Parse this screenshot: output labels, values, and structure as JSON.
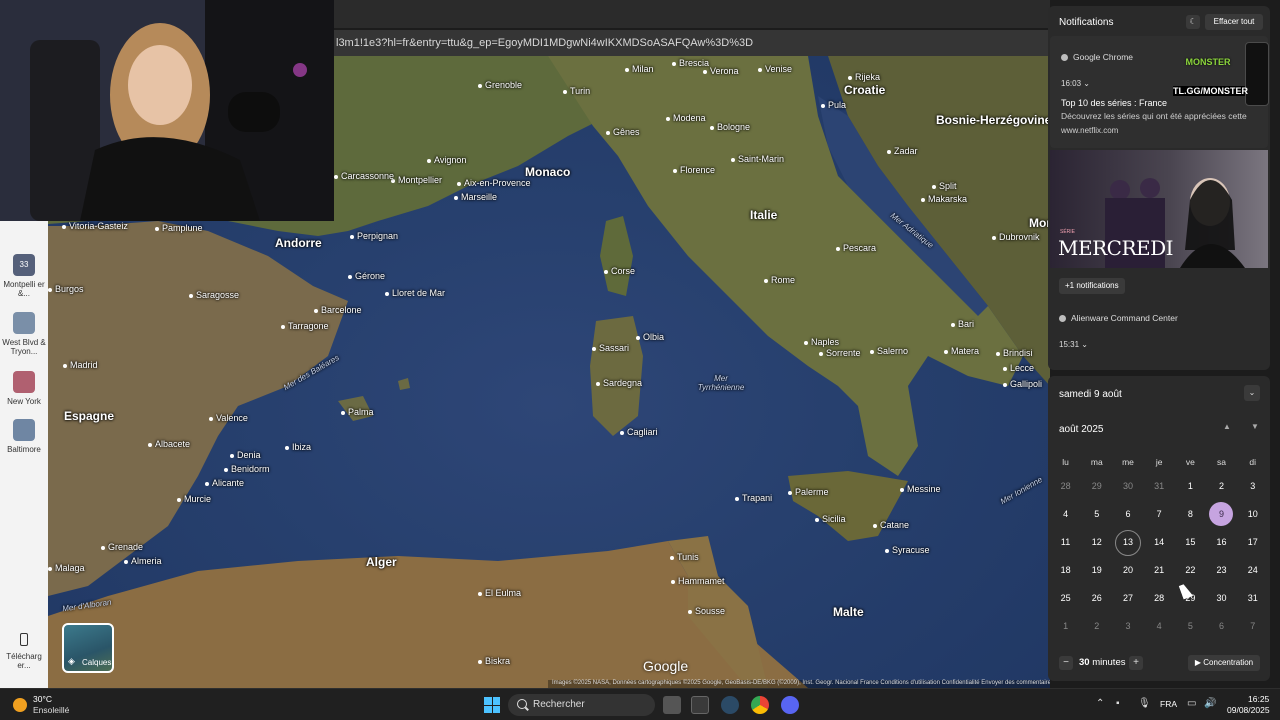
{
  "browser": {
    "url": "l3m1!1e3?hl=fr&entry=ttu&g_ep=EgoyMDI1MDgwNi4wIKXMDSoASAFQAw%3D%3D"
  },
  "map": {
    "countries": [
      "Croatie",
      "Bosnie-Herzégovine",
      "Monaco",
      "Italie",
      "Andorre",
      "Espagne",
      "Alger",
      "Malte",
      "Mon"
    ],
    "cities": [
      "Milan",
      "Brescia",
      "Verona",
      "Venise",
      "Rijeka",
      "Turin",
      "Modena",
      "Bologne",
      "Pula",
      "Grenoble",
      "Gênes",
      "Saint-Marin",
      "Florence",
      "Zadar",
      "Split",
      "Makarska",
      "Montpellier",
      "Avignon",
      "Aix-en-Provence",
      "Marseille",
      "Dubrovnik",
      "Pescara",
      "Perpignan",
      "Corse",
      "Rome",
      "Bari",
      "Gérone",
      "Lloret de Mar",
      "Saragosse",
      "Tarragone",
      "Barcelone",
      "Sassari",
      "Olbia",
      "Naples",
      "Sorrente",
      "Salerno",
      "Matera",
      "Brindisi",
      "Lecce",
      "Gallipoli",
      "Madrid",
      "Sardegna",
      "Valence",
      "Palma",
      "Cagliari",
      "Ibiza",
      "Denia",
      "Benidorm",
      "Alicante",
      "Albacete",
      "Palerme",
      "Messine",
      "Trapani",
      "Sicilia",
      "Catane",
      "Syracuse",
      "Murcie",
      "Grenade",
      "Almeria",
      "Malaga",
      "Tunis",
      "Hammamet",
      "Sousse",
      "El Eulma",
      "Biskra",
      "Vitoria-Gasteiz",
      "Pamplune",
      "Burgos",
      "Carcassonne"
    ],
    "seas": [
      "Mer des Baléares",
      "Mer Tyrrhénienne",
      "Mer Adriatique",
      "Mer Ionienne",
      "Mer d'Alboran"
    ],
    "google_logo": "Google",
    "attribution": "Images ©2025 NASA, Données cartographiques ©2025 Google, GeoBasis-DE/BKG (©2009), Inst. Geogr. Nacional   France   Conditions d'utilisation   Confidentialité   Envoyer des commentaires sur le produit   100 km",
    "layers_label": "Calques"
  },
  "sidebar": {
    "recent": [
      {
        "label": "Montpelli er &...",
        "badge": "33",
        "color": "#55607a"
      },
      {
        "label": "West Blvd & Tryon...",
        "color": "#7a8fa8"
      },
      {
        "label": "New York",
        "color": "#b06070"
      },
      {
        "label": "Baltimore",
        "color": "#6f86a3"
      }
    ],
    "download_label": "Télécharg er..."
  },
  "notifications": {
    "title": "Notifications",
    "clear_all": "Effacer tout",
    "card1": {
      "app": "Google Chrome",
      "time": "16:03",
      "headline": "Top 10 des séries : France",
      "body": "Découvrez les séries qui ont été appréciées cette",
      "link": "www.netflix.com"
    },
    "ad_text": "TL.GG/MONSTER",
    "ad_brand": "MONSTER",
    "poster_title": "MERCREDI",
    "poster_tag": "SÉRIE",
    "more": "+1 notifications",
    "card2": {
      "app": "Alienware Command Center",
      "time": "15:31"
    }
  },
  "calendar": {
    "date_header": "samedi 9 août",
    "month": "août 2025",
    "weekdays": [
      "lu",
      "ma",
      "me",
      "je",
      "ve",
      "sa",
      "di"
    ],
    "days": [
      "28",
      "29",
      "30",
      "31",
      "1",
      "2",
      "3",
      "4",
      "5",
      "6",
      "7",
      "8",
      "9",
      "10",
      "11",
      "12",
      "13",
      "14",
      "15",
      "16",
      "17",
      "18",
      "19",
      "20",
      "21",
      "22",
      "23",
      "24",
      "25",
      "26",
      "27",
      "28",
      "29",
      "30",
      "31",
      "1",
      "2",
      "3",
      "4",
      "5",
      "6",
      "7"
    ],
    "selected_day_index": 12,
    "today_day_index": 16,
    "focus_minutes": "30",
    "focus_unit": "minutes",
    "focus_button": "Concentration"
  },
  "taskbar": {
    "weather_temp": "30°C",
    "weather_desc": "Ensoleillé",
    "search_placeholder": "Rechercher",
    "language": "FRA",
    "time": "16:25",
    "date": "09/08/2025",
    "accent": "#4cc2ff"
  }
}
